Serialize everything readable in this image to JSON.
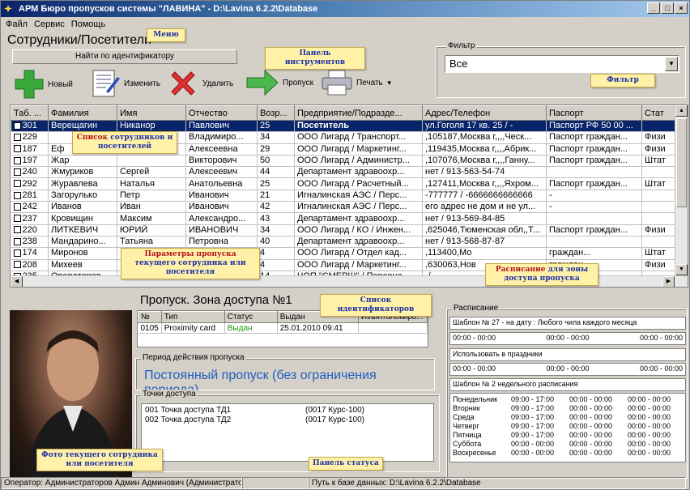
{
  "window": {
    "title": "АРМ Бюро пропусков системы \"ЛАВИНА\" - D:\\Lavina 6.2.2\\Database",
    "min": "_",
    "max": "□",
    "close": "×"
  },
  "menu": [
    "Файл",
    "Сервис",
    "Помощь"
  ],
  "section_title": "Сотрудники/Посетители",
  "find_button": "Найти по идентификатору",
  "toolbar": {
    "new": "Новый",
    "edit": "Изменить",
    "delete": "Удалить",
    "pass": "Пропуск",
    "print": "Печать"
  },
  "filter": {
    "legend": "Фильтр",
    "value": "Все"
  },
  "grid": {
    "columns": [
      "Таб. ...",
      "Фамилия",
      "Имя",
      "Отчество",
      "Возр...",
      "Предприятие/Подразде...",
      "Адрес/Телефон",
      "Паспорт",
      "Стат"
    ],
    "rows": [
      [
        "301",
        "Верещагин",
        "Никанор",
        "Павлович",
        "25",
        "Посетитель",
        "ул.Гоголя 17 кв. 25 / -",
        "Паспорт РФ 50 00 ...",
        ""
      ],
      [
        "229",
        "",
        "",
        "Владимиро...",
        "34",
        "ООО Лигард / Транспорт...",
        ",105187,Москва г,,,,Ческ...",
        "Паспорт граждан...",
        "Физи"
      ],
      [
        "187",
        "Еф",
        "",
        "Алексеевна",
        "29",
        "ООО Лигард / Маркетинг...",
        ",119435,Москва г,,,,Абрик...",
        "Паспорт граждан...",
        "Физи"
      ],
      [
        "197",
        "Жар",
        "",
        "Викторович",
        "50",
        "ООО Лигард / Администр...",
        ",107076,Москва г,,,,Ганну...",
        "Паспорт граждан...",
        "Штат"
      ],
      [
        "240",
        "Жмуриков",
        "Сергей",
        "Алексеевич",
        "44",
        "Департамент здравоохр...",
        "нет / 913-563-54-74",
        "",
        ""
      ],
      [
        "292",
        "Журавлева",
        "Наталья",
        "Анатольевна",
        "25",
        "ООО Лигард / Расчетный...",
        ",127411,Москва г,,,,Яхром...",
        "Паспорт граждан...",
        "Штат"
      ],
      [
        "281",
        "Загорулько",
        "Петр",
        "Иванович",
        "21",
        "Игналинская АЭС / Перс...",
        "-777777 / -6666666666666",
        "-",
        ""
      ],
      [
        "242",
        "Иванов",
        "Иван",
        "Иванович",
        "42",
        "Игналинская АЭС / Перс...",
        "его адрес не дом и не ул...",
        "-",
        ""
      ],
      [
        "237",
        "Кровищин",
        "Максим",
        "Александро...",
        "43",
        "Департамент здравоохр...",
        "нет / 913-569-84-85",
        "",
        ""
      ],
      [
        "220",
        "ЛИТКЕВИЧ",
        "ЮРИЙ",
        "ИВАНОВИЧ",
        "34",
        "ООО Лигард / КО / Инжен...",
        ",625046,Тюменская обл,,Т...",
        "Паспорт граждан...",
        "Физи"
      ],
      [
        "238",
        "Мандарино...",
        "Татьяна",
        "Петровна",
        "40",
        "Департамент здравоохр...",
        "нет / 913-568-87-87",
        "",
        ""
      ],
      [
        "174",
        "Миронов",
        "",
        "",
        "4",
        "ООО Лигард / Отдел кад...",
        ",113400,Мо",
        "граждан...",
        "Штат"
      ],
      [
        "208",
        "Михеев",
        "",
        "",
        "4",
        "ООО Лигард / Маркетинг...",
        ",630063,Нов",
        "граждан...",
        "Физи"
      ],
      [
        "235",
        "Операторов",
        "",
        "Оператович",
        "14",
        "ЧОП \"СМЕРШ\" / Персона...",
        "-/",
        "",
        ""
      ]
    ]
  },
  "pass": {
    "title": "Пропуск. Зона доступа №1",
    "id_columns": [
      "№",
      "Тип",
      "Статус",
      "Выдан",
      "Изъят/блокиро..."
    ],
    "id_rows": [
      [
        "0105",
        "Proximity card",
        "Выдан",
        "25.01.2010  09:41",
        ""
      ]
    ],
    "period_legend": "Период действия пропуска",
    "period_text": "Постоянный пропуск (без ограничения периода)",
    "points_legend": "Точки доступа",
    "points": [
      [
        "001 Точка доступа ТД1",
        "(0017  Курс-100)"
      ],
      [
        "002 Точка доступа ТД2",
        "(0017  Курс-100)"
      ]
    ]
  },
  "schedule": {
    "legend": "Расписание",
    "template1": "Шаблон № 27 - на дату : Любого чила каждого месяца",
    "time_row": [
      "00:00 - 00:00",
      "00:00 - 00:00",
      "00:00 - 00:00"
    ],
    "holidays": "Использовать в праздники",
    "template2": "Шаблон № 2 недельного расписания",
    "week": [
      [
        "Понедельник",
        "09:00 - 17:00",
        "00:00 - 00:00",
        "00:00 - 00:00"
      ],
      [
        "Вторник",
        "09:00 - 17:00",
        "00:00 - 00:00",
        "00:00 - 00:00"
      ],
      [
        "Среда",
        "09:00 - 17:00",
        "00:00 - 00:00",
        "00:00 - 00:00"
      ],
      [
        "Четверг",
        "09:00 - 17:00",
        "00:00 - 00:00",
        "00:00 - 00:00"
      ],
      [
        "Пятница",
        "09:00 - 17:00",
        "00:00 - 00:00",
        "00:00 - 00:00"
      ],
      [
        "Суббота",
        "00:00 - 00:00",
        "00:00 - 00:00",
        "00:00 - 00:00"
      ],
      [
        "Воскресенье",
        "00:00 - 00:00",
        "00:00 - 00:00",
        "00:00 - 00:00"
      ]
    ]
  },
  "status": {
    "operator": "Оператор: Администраторов Админ Админович (Администратор)",
    "path": "Путь к базе данных: D:\\Lavina 6.2.2\\Database"
  },
  "callouts": {
    "menu": "Меню",
    "toolbar": "Панель инструментов",
    "filter": "Фильтр",
    "list_a": "Список",
    "list_b": " сотрудников и посетителей",
    "params_a": "Параметры пропуска",
    "params_b": " текущего сотрудника или посетителя",
    "ids": "Список идентификаторов",
    "sched_a": "Расписание",
    "sched_b": " для зоны доступа пропуска",
    "photo": "Фото текущего сотрудника или посетителя",
    "status": "Панель статуса"
  }
}
